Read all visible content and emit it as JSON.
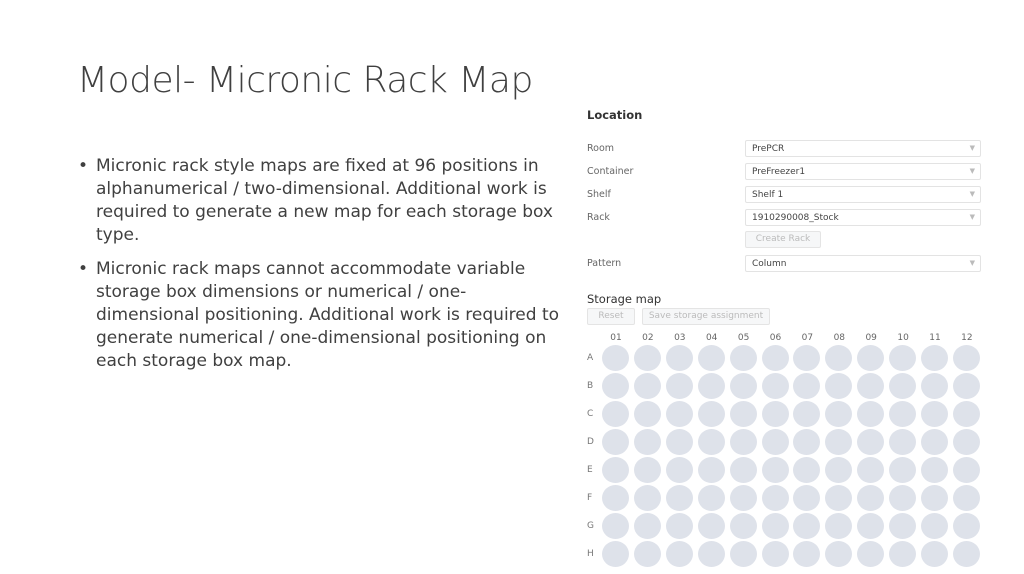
{
  "slide": {
    "title": "Model- Micronic Rack Map",
    "bullets": [
      "Micronic rack style maps are fixed at 96 positions in alphanumerical / two-dimensional.  Additional work is required to generate a new map for each storage box type.",
      "Micronic rack maps cannot accommodate variable storage box dimensions or numerical / one-dimensional positioning.  Additional work is required to generate numerical / one-dimensional positioning on each storage box map."
    ]
  },
  "location": {
    "heading": "Location",
    "fields": [
      {
        "label": "Room",
        "value": "PrePCR"
      },
      {
        "label": "Container",
        "value": "PreFreezer1"
      },
      {
        "label": "Shelf",
        "value": "Shelf 1"
      },
      {
        "label": "Rack",
        "value": "1910290008_Stock"
      }
    ],
    "create_rack": "Create Rack",
    "pattern": {
      "label": "Pattern",
      "value": "Column"
    }
  },
  "storage_map": {
    "heading": "Storage map",
    "reset": "Reset",
    "save": "Save storage assignment",
    "columns": [
      "01",
      "02",
      "03",
      "04",
      "05",
      "06",
      "07",
      "08",
      "09",
      "10",
      "11",
      "12"
    ],
    "rows": [
      "A",
      "B",
      "C",
      "D",
      "E",
      "F",
      "G",
      "H"
    ],
    "well_color": "#dee2ea"
  }
}
